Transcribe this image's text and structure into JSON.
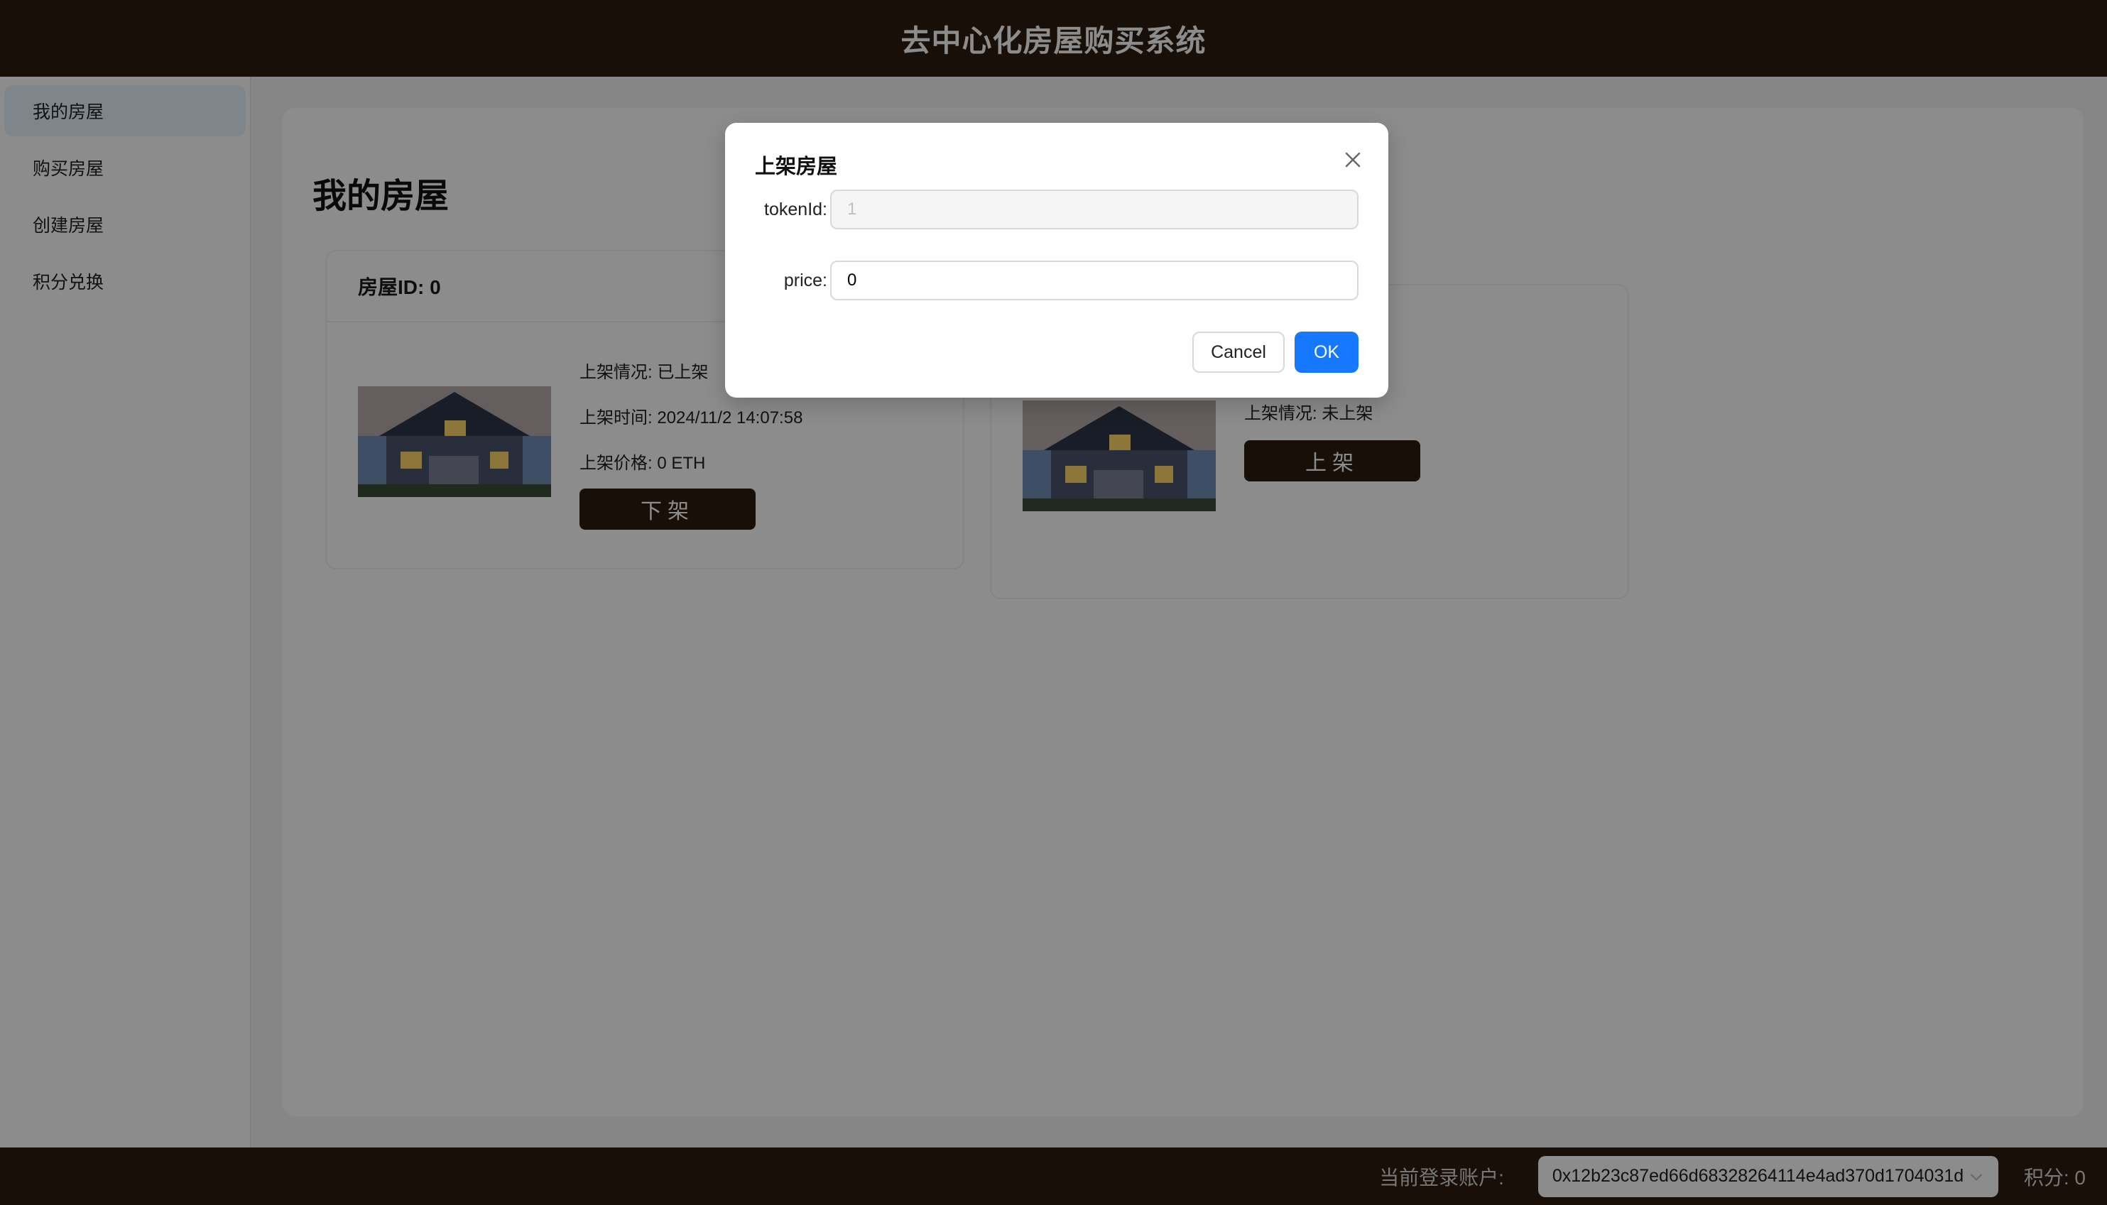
{
  "header": {
    "title": "去中心化房屋购买系统"
  },
  "sidebar": {
    "items": [
      {
        "label": "我的房屋"
      },
      {
        "label": "购买房屋"
      },
      {
        "label": "创建房屋"
      },
      {
        "label": "积分兑换"
      }
    ]
  },
  "main": {
    "title": "我的房屋",
    "cards": [
      {
        "head": "房屋ID: 0",
        "status": "上架情况: 已上架",
        "time": "上架时间: 2024/11/2 14:07:58",
        "price": "上架价格: 0 ETH",
        "button": "下架"
      },
      {
        "status": "上架情况: 未上架",
        "button": "上架"
      }
    ]
  },
  "modal": {
    "title": "上架房屋",
    "tokenid_label": "tokenId:",
    "tokenid_value": "1",
    "price_label": "price:",
    "price_value": "0",
    "cancel": "Cancel",
    "ok": "OK"
  },
  "footer": {
    "account_label": "当前登录账户:",
    "account": "0x12b23c87ed66d68328264114e4ad370d1704031d",
    "points": "积分: 0"
  },
  "colors": {
    "dark": "#2c1e0f",
    "primary": "#1677ff"
  }
}
